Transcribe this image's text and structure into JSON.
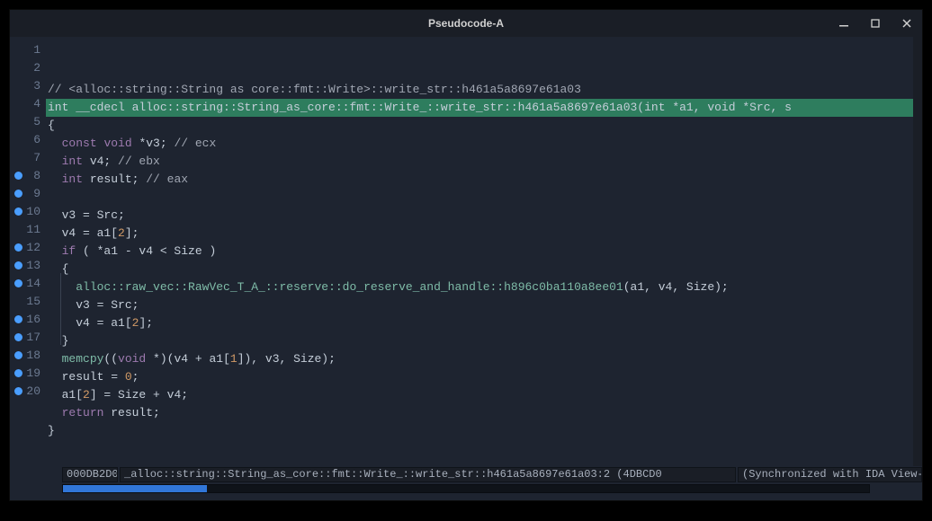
{
  "window": {
    "title": "Pseudocode-A"
  },
  "breakpoints": [
    8,
    9,
    10,
    12,
    13,
    14,
    16,
    17,
    18,
    19,
    20
  ],
  "lines": [
    {
      "n": 1,
      "tokens": [
        {
          "c": "comment",
          "t": "// <alloc::string::String as core::fmt::Write>::write_str::h461a5a8697e61a03"
        }
      ]
    },
    {
      "n": 2,
      "highlight": true,
      "tokens": [
        {
          "c": "hl-text",
          "t": "int __cdecl alloc::string::String_as_core::fmt::Write_::write_str::h461a5a8697e61a03(int *a1, void *Src, s"
        }
      ]
    },
    {
      "n": 3,
      "tokens": [
        {
          "c": "paren",
          "t": "{"
        }
      ]
    },
    {
      "n": 4,
      "tokens": [
        {
          "c": "var",
          "t": "  "
        },
        {
          "c": "kw",
          "t": "const"
        },
        {
          "c": "var",
          "t": " "
        },
        {
          "c": "kw",
          "t": "void"
        },
        {
          "c": "var",
          "t": " *v3; "
        },
        {
          "c": "comment",
          "t": "// ecx"
        }
      ]
    },
    {
      "n": 5,
      "tokens": [
        {
          "c": "var",
          "t": "  "
        },
        {
          "c": "kw",
          "t": "int"
        },
        {
          "c": "var",
          "t": " v4; "
        },
        {
          "c": "comment",
          "t": "// ebx"
        }
      ]
    },
    {
      "n": 6,
      "tokens": [
        {
          "c": "var",
          "t": "  "
        },
        {
          "c": "kw",
          "t": "int"
        },
        {
          "c": "var",
          "t": " result; "
        },
        {
          "c": "comment",
          "t": "// eax"
        }
      ]
    },
    {
      "n": 7,
      "tokens": []
    },
    {
      "n": 8,
      "tokens": [
        {
          "c": "var",
          "t": "  v3 = Src;"
        }
      ]
    },
    {
      "n": 9,
      "tokens": [
        {
          "c": "var",
          "t": "  v4 = a1["
        },
        {
          "c": "num",
          "t": "2"
        },
        {
          "c": "var",
          "t": "];"
        }
      ]
    },
    {
      "n": 10,
      "tokens": [
        {
          "c": "var",
          "t": "  "
        },
        {
          "c": "kw",
          "t": "if"
        },
        {
          "c": "var",
          "t": " ( *a1 - v4 < Size )"
        }
      ]
    },
    {
      "n": 11,
      "tokens": [
        {
          "c": "var",
          "t": "  {"
        }
      ]
    },
    {
      "n": 12,
      "tokens": [
        {
          "c": "var",
          "t": "    "
        },
        {
          "c": "func",
          "t": "alloc::raw_vec::RawVec_T_A_::reserve::do_reserve_and_handle::h896c0ba110a8ee01"
        },
        {
          "c": "var",
          "t": "(a1, v4, Size);"
        }
      ]
    },
    {
      "n": 13,
      "tokens": [
        {
          "c": "var",
          "t": "    v3 = Src;"
        }
      ]
    },
    {
      "n": 14,
      "tokens": [
        {
          "c": "var",
          "t": "    v4 = a1["
        },
        {
          "c": "num",
          "t": "2"
        },
        {
          "c": "var",
          "t": "];"
        }
      ]
    },
    {
      "n": 15,
      "tokens": [
        {
          "c": "var",
          "t": "  }"
        }
      ]
    },
    {
      "n": 16,
      "tokens": [
        {
          "c": "var",
          "t": "  "
        },
        {
          "c": "func",
          "t": "memcpy"
        },
        {
          "c": "var",
          "t": "(("
        },
        {
          "c": "kw",
          "t": "void"
        },
        {
          "c": "var",
          "t": " *)(v4 + a1["
        },
        {
          "c": "num",
          "t": "1"
        },
        {
          "c": "var",
          "t": "]), v3, Size);"
        }
      ]
    },
    {
      "n": 17,
      "tokens": [
        {
          "c": "var",
          "t": "  result = "
        },
        {
          "c": "num",
          "t": "0"
        },
        {
          "c": "var",
          "t": ";"
        }
      ]
    },
    {
      "n": 18,
      "tokens": [
        {
          "c": "var",
          "t": "  a1["
        },
        {
          "c": "num",
          "t": "2"
        },
        {
          "c": "var",
          "t": "] = Size + v4;"
        }
      ]
    },
    {
      "n": 19,
      "tokens": [
        {
          "c": "var",
          "t": "  "
        },
        {
          "c": "kw",
          "t": "return"
        },
        {
          "c": "var",
          "t": " result;"
        }
      ]
    },
    {
      "n": 20,
      "tokens": [
        {
          "c": "var",
          "t": "}"
        }
      ]
    }
  ],
  "status": {
    "address": "000DB2D0",
    "func": "_alloc::string::String_as_core::fmt::Write_::write_str::h461a5a8697e61a03:2 (4DBCD0",
    "sync": "(Synchronized with IDA View-A)"
  }
}
